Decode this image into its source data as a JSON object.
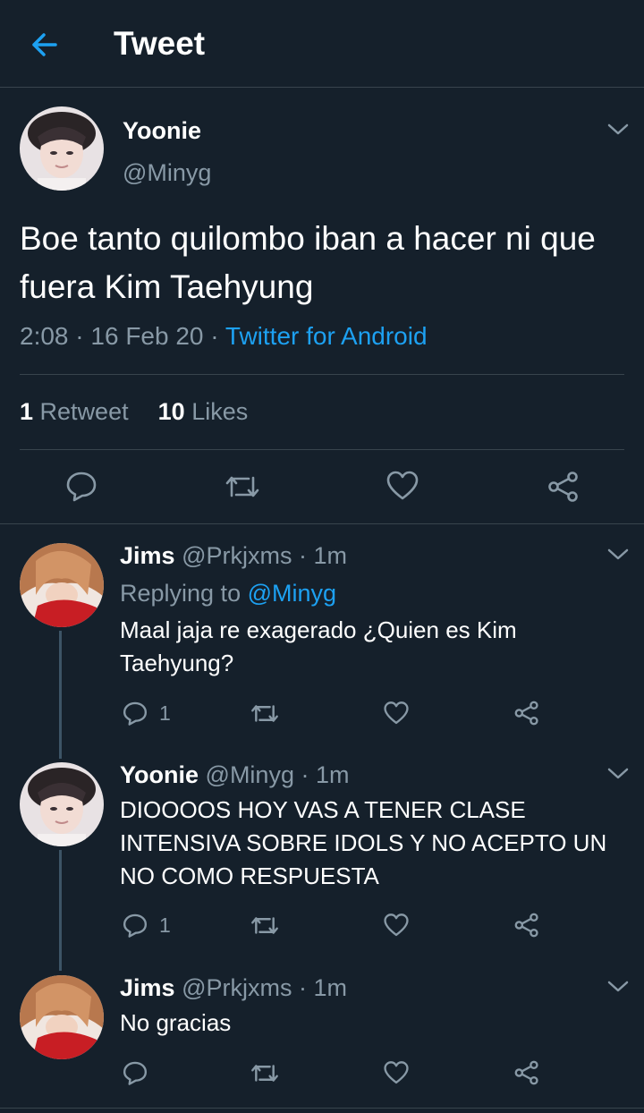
{
  "header": {
    "title": "Tweet",
    "back_icon": "arrow-left-icon",
    "accent": "#1da1f2"
  },
  "main_tweet": {
    "name": "Yoonie",
    "handle": "@Minyg",
    "text": "Boe tanto quilombo iban a hacer ni que fuera Kim Taehyung",
    "time": "2:08",
    "date": "16 Feb 20",
    "sep": "·",
    "source": "Twitter for Android",
    "retweets": "1",
    "retweets_label": "Retweet",
    "likes": "10",
    "likes_label": "Likes"
  },
  "replies": [
    {
      "name": "Jims",
      "handle": "@Prkjxms",
      "time": "1m",
      "sep": "·",
      "replying_label": "Replying to",
      "replying_to": "@Minyg",
      "text": "Maal jaja re exagerado ¿Quien es Kim Taehyung?",
      "reply_count": "1"
    },
    {
      "name": "Yoonie",
      "handle": "@Minyg",
      "time": "1m",
      "sep": "·",
      "text": "DIOOOOS HOY VAS A TENER CLASE INTENSIVA SOBRE IDOLS Y NO ACEPTO UN NO COMO RESPUESTA",
      "reply_count": "1"
    },
    {
      "name": "Jims",
      "handle": "@Prkjxms",
      "time": "1m",
      "sep": "·",
      "text": "No gracias",
      "reply_count": ""
    }
  ],
  "colors": {
    "background": "#15202b",
    "muted": "#8899a6",
    "divider": "#38444d",
    "link": "#1da1f2"
  }
}
